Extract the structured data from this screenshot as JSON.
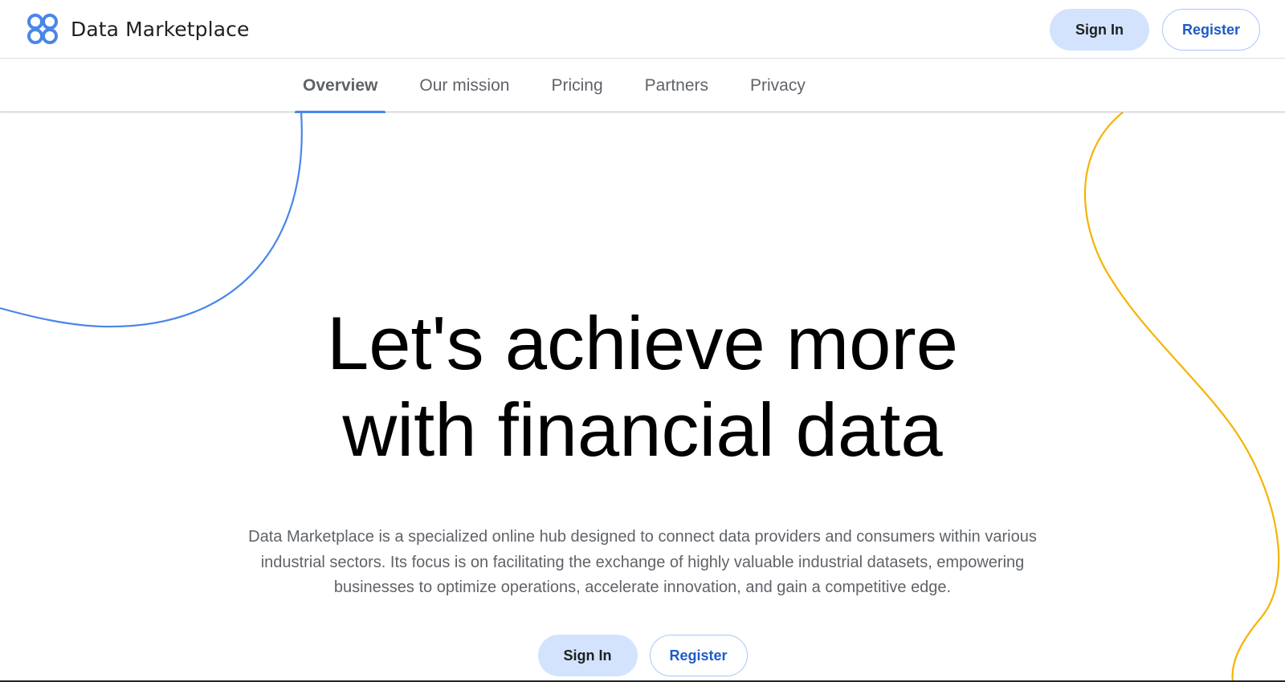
{
  "header": {
    "brand_name": "Data Marketplace",
    "logo_icon": "clover-logo-icon",
    "sign_in_label": "Sign In",
    "register_label": "Register"
  },
  "nav": {
    "tabs": [
      {
        "label": "Overview",
        "active": true
      },
      {
        "label": "Our mission",
        "active": false
      },
      {
        "label": "Pricing",
        "active": false
      },
      {
        "label": "Partners",
        "active": false
      },
      {
        "label": "Privacy",
        "active": false
      }
    ]
  },
  "hero": {
    "title_line1": "Let's achieve more",
    "title_line2": "with financial data",
    "description": "Data Marketplace is a specialized online hub designed to connect data providers and consumers within various industrial sectors. Its focus is on facilitating the exchange of highly valuable industrial datasets, empowering businesses to optimize operations, accelerate innovation, and gain a competitive edge.",
    "sign_in_label": "Sign In",
    "register_label": "Register"
  },
  "colors": {
    "accent_blue": "#4a86e8",
    "accent_yellow": "#f4b400",
    "primary_button_bg": "#d3e3fd",
    "outline_button_text": "#1f5bc7"
  }
}
